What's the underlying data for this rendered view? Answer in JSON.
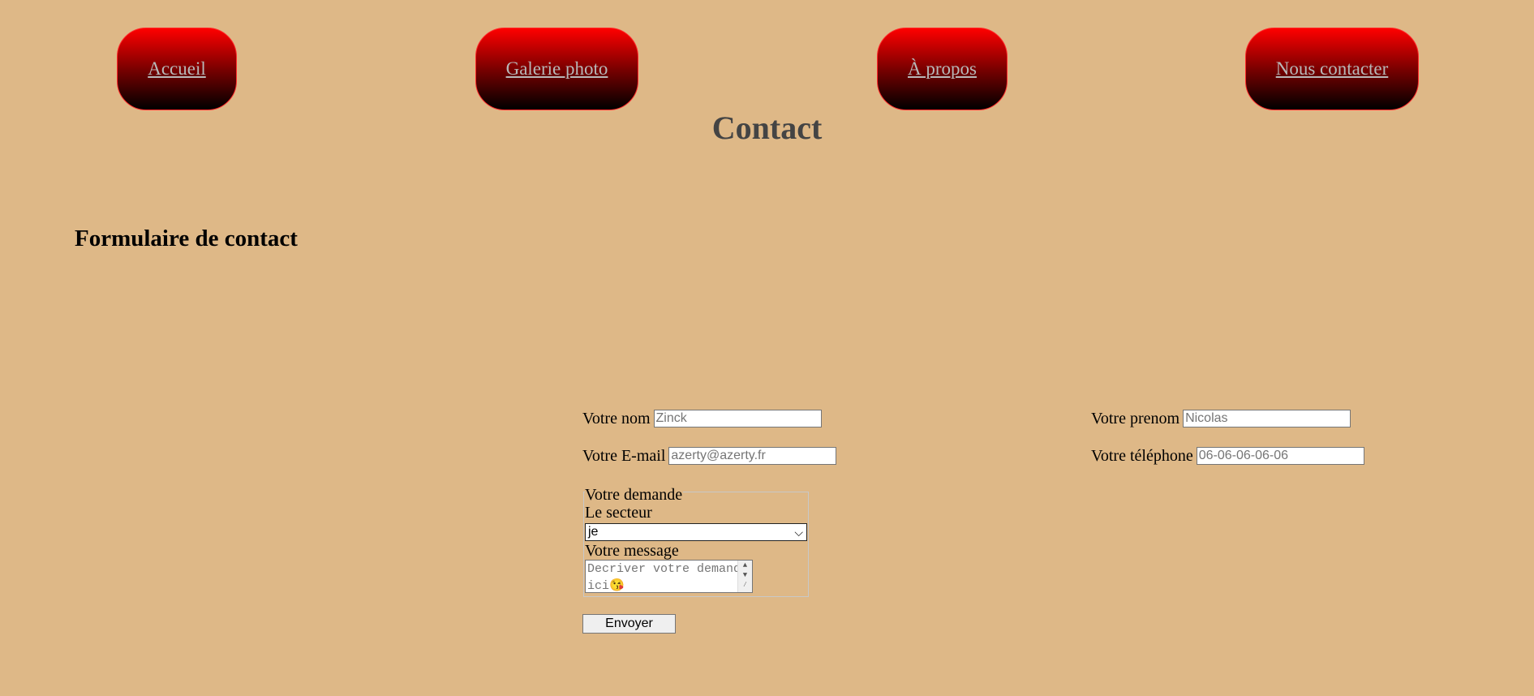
{
  "nav": {
    "items": [
      {
        "label": "Accueil"
      },
      {
        "label": "Galerie photo"
      },
      {
        "label": "À propos"
      },
      {
        "label": "Nous contacter"
      }
    ]
  },
  "page": {
    "title": "Contact",
    "section_title": "Formulaire de contact"
  },
  "form": {
    "nom": {
      "label": "Votre nom",
      "placeholder": "Zinck"
    },
    "prenom": {
      "label": "Votre prenom",
      "placeholder": "Nicolas"
    },
    "email": {
      "label": "Votre E-mail",
      "placeholder": "azerty@azerty.fr"
    },
    "telephone": {
      "label": "Votre téléphone",
      "placeholder": "06-06-06-06-06"
    },
    "demande": {
      "legend": "Votre demande",
      "secteur_label": "Le secteur",
      "secteur_value": "je",
      "message_label": "Votre message",
      "message_placeholder": "Decriver votre demande ici😘"
    },
    "submit_label": "Envoyer"
  },
  "colors": {
    "background": "#deb887",
    "nav_gradient_top": "#ff0000",
    "nav_gradient_bottom": "#000000",
    "nav_text": "#b8b8b8",
    "title_text": "#444444"
  }
}
